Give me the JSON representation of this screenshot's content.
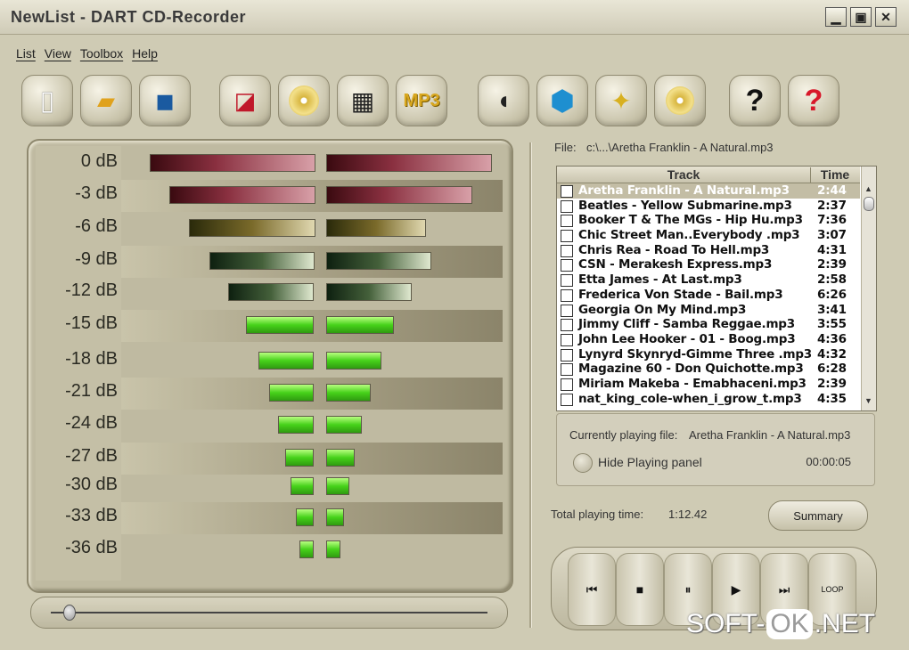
{
  "window": {
    "title": "NewList - DART CD-Recorder",
    "min": "▁",
    "max": "▣",
    "close": "✕"
  },
  "menu": [
    "List",
    "View",
    "Toolbox",
    "Help"
  ],
  "toolbar": [
    {
      "icon": "new-file-icon",
      "glyph": "🗋"
    },
    {
      "icon": "open-folder-icon",
      "glyph": "📂"
    },
    {
      "icon": "save-icon",
      "glyph": "💾"
    },
    {
      "icon": "eraser-icon",
      "glyph": "◪"
    },
    {
      "icon": "cd-icon",
      "glyph": "💿"
    },
    {
      "icon": "equalizer-icon",
      "glyph": "▦"
    },
    {
      "icon": "mp3-icon",
      "glyph": "MP3"
    },
    {
      "icon": "mouse-icon",
      "glyph": "🖱"
    },
    {
      "icon": "box-icon",
      "glyph": "⬢"
    },
    {
      "icon": "wizard-wand-icon",
      "glyph": "✦"
    },
    {
      "icon": "cd-wizard-icon",
      "glyph": "💿"
    },
    {
      "icon": "help-icon",
      "glyph": "?"
    },
    {
      "icon": "context-help-icon",
      "glyph": "?"
    }
  ],
  "meter": {
    "db_labels": [
      "0 dB",
      "-3 dB",
      "-6 dB",
      "-9 dB",
      "-12 dB",
      "-15 dB",
      "-18 dB",
      "-21 dB",
      "-24 dB",
      "-27 dB",
      "-30 dB",
      "-33 dB",
      "-36 dB"
    ]
  },
  "file": {
    "label": "File:",
    "value": "c:\\...\\Aretha Franklin - A Natural.mp3"
  },
  "tracklist": {
    "col_track": "Track",
    "col_time": "Time",
    "rows": [
      {
        "name": "Aretha Franklin - A Natural.mp3",
        "time": "2:44",
        "selected": true
      },
      {
        "name": "Beatles - Yellow Submarine.mp3",
        "time": "2:37"
      },
      {
        "name": "Booker T & The MGs - Hip Hu.mp3",
        "time": "7:36"
      },
      {
        "name": "Chic Street Man..Everybody .mp3",
        "time": "3:07"
      },
      {
        "name": "Chris Rea - Road To Hell.mp3",
        "time": "4:31"
      },
      {
        "name": "CSN - Merakesh Express.mp3",
        "time": "2:39"
      },
      {
        "name": "Etta James - At Last.mp3",
        "time": "2:58"
      },
      {
        "name": "Frederica Von Stade  - Bail.mp3",
        "time": "6:26"
      },
      {
        "name": "Georgia On My Mind.mp3",
        "time": "3:41"
      },
      {
        "name": "Jimmy Cliff -  Samba Reggae.mp3",
        "time": "3:55"
      },
      {
        "name": "John Lee Hooker - 01 - Boog.mp3",
        "time": "4:36"
      },
      {
        "name": "Lynyrd Skynryd-Gimme Three .mp3",
        "time": "4:32"
      },
      {
        "name": "Magazine 60 - Don Quichotte.mp3",
        "time": "6:28"
      },
      {
        "name": "Miriam Makeba - Emabhaceni.mp3",
        "time": "2:39"
      },
      {
        "name": "nat_king_cole-when_i_grow_t.mp3",
        "time": "4:35"
      }
    ]
  },
  "playing": {
    "label": "Currently playing file:",
    "value": "Aretha Franklin - A Natural.mp3",
    "hide_label": "Hide Playing panel",
    "time": "00:00:05"
  },
  "total": {
    "label": "Total playing time:",
    "value": "1:12.42"
  },
  "summary_label": "Summary",
  "transport": [
    {
      "name": "previous-track-button",
      "glyph": "⏮"
    },
    {
      "name": "stop-button",
      "glyph": "■"
    },
    {
      "name": "pause-button",
      "glyph": "⏸"
    },
    {
      "name": "play-button",
      "glyph": "▶"
    },
    {
      "name": "next-track-button",
      "glyph": "⏭"
    },
    {
      "name": "loop-button",
      "glyph": "LOOP"
    }
  ],
  "watermark": {
    "part1": "SOFT-",
    "part2": "OK",
    "part3": ".NET"
  }
}
